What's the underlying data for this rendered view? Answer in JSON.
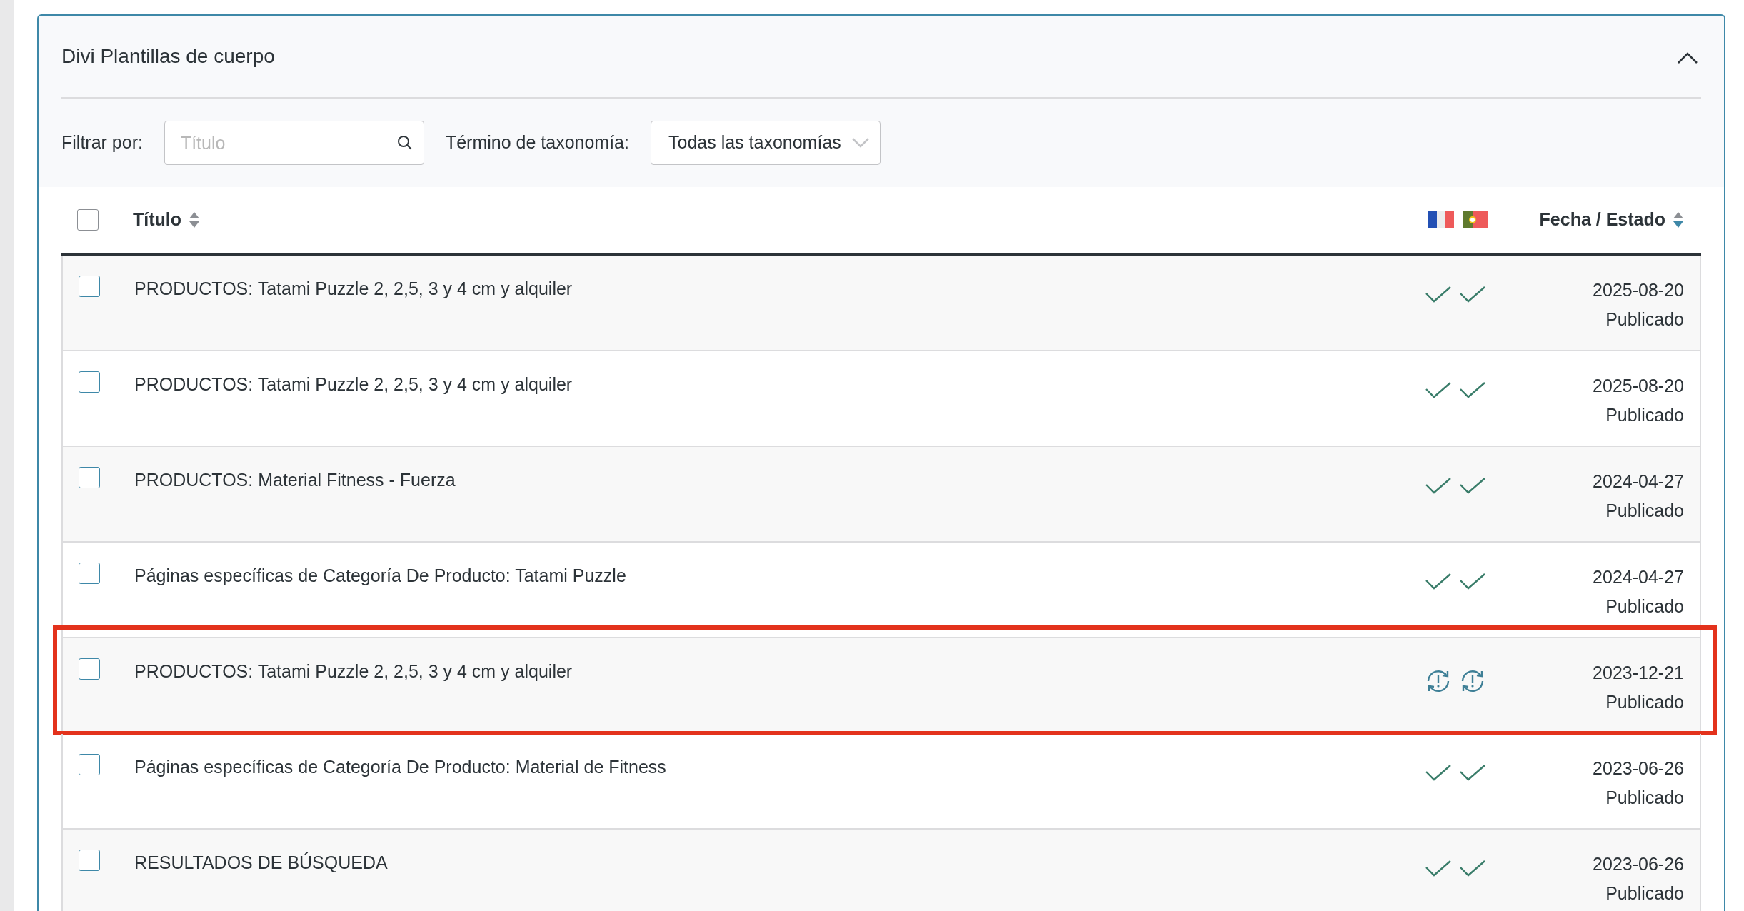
{
  "panel": {
    "title": "Divi Plantillas de cuerpo",
    "expanded": true
  },
  "filter": {
    "label": "Filtrar por:",
    "search_placeholder": "Título",
    "taxonomy_label": "Término de taxonomía:",
    "taxonomy_value": "Todas las taxonomías"
  },
  "table": {
    "columns": [
      {
        "label": "Título",
        "sorted": false
      },
      {
        "label": "Fecha / Estado",
        "sorted": true
      }
    ],
    "all_checked": false,
    "rows": [
      {
        "title": "PRODUCTOS: Tatami Puzzle 2, 2,5, 3 y 4 cm y alquiler",
        "checked": false,
        "translations": [
          {
            "needs_update": false
          },
          {
            "needs_update": false
          }
        ],
        "date": "2025-08-20",
        "status": "Publicado",
        "highlighted": false
      },
      {
        "title": "PRODUCTOS: Tatami Puzzle 2, 2,5, 3 y 4 cm y alquiler",
        "checked": false,
        "translations": [
          {
            "needs_update": false
          },
          {
            "needs_update": false
          }
        ],
        "date": "2025-08-20",
        "status": "Publicado",
        "highlighted": false
      },
      {
        "title": "PRODUCTOS: Material Fitness - Fuerza",
        "checked": false,
        "translations": [
          {
            "needs_update": false
          },
          {
            "needs_update": false
          }
        ],
        "date": "2024-04-27",
        "status": "Publicado",
        "highlighted": false
      },
      {
        "title": "Páginas específicas de Categoría De Producto: Tatami Puzzle",
        "checked": false,
        "translations": [
          {
            "needs_update": false
          },
          {
            "needs_update": false
          }
        ],
        "date": "2024-04-27",
        "status": "Publicado",
        "highlighted": false
      },
      {
        "title": "PRODUCTOS: Tatami Puzzle 2, 2,5, 3 y 4 cm y alquiler",
        "checked": false,
        "translations": [
          {
            "needs_update": true
          },
          {
            "needs_update": true
          }
        ],
        "date": "2023-12-21",
        "status": "Publicado",
        "highlighted": true
      },
      {
        "title": "Páginas específicas de Categoría De Producto: Material de Fitness",
        "checked": false,
        "translations": [
          {
            "needs_update": false
          },
          {
            "needs_update": false
          }
        ],
        "date": "2023-06-26",
        "status": "Publicado",
        "highlighted": false
      },
      {
        "title": "RESULTADOS DE BÚSQUEDA",
        "checked": false,
        "translations": [
          {
            "needs_update": false
          },
          {
            "needs_update": false
          }
        ],
        "date": "2023-06-26",
        "status": "Publicado",
        "highlighted": false
      }
    ]
  }
}
